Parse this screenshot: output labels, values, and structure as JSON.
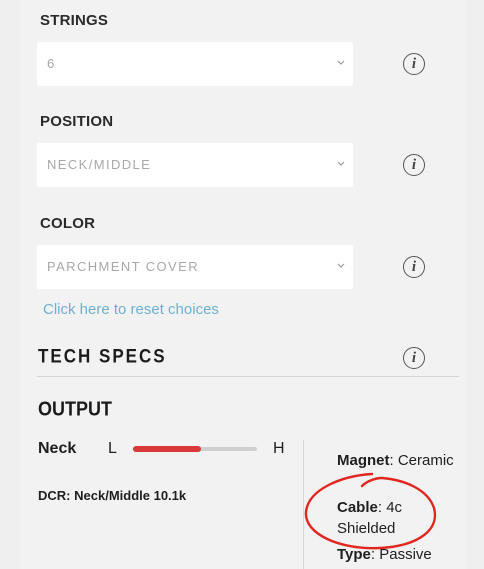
{
  "options": [
    {
      "label": "STRINGS",
      "value": "6"
    },
    {
      "label": "POSITION",
      "value": "NECK/MIDDLE"
    },
    {
      "label": "COLOR",
      "value": "PARCHMENT COVER"
    }
  ],
  "info_glyph": "i",
  "reset_link": "Click here to reset choices",
  "tech_specs": {
    "title": "TECH SPECS",
    "output_title": "OUTPUT",
    "neck_label": "Neck",
    "low_label": "L",
    "high_label": "H",
    "output_level": 0.55,
    "dcr_label": "DCR:",
    "dcr_value": "Neck/Middle 10.1k",
    "specs": [
      {
        "key": "Magnet",
        "value": "Ceramic"
      },
      {
        "key": "Cable",
        "value": "4c Shielded"
      },
      {
        "key": "Type",
        "value": "Passive"
      }
    ]
  },
  "colors": {
    "accent_red": "#d8393b",
    "link_blue": "#6fb0d0",
    "annotation_red": "#e0261f"
  }
}
